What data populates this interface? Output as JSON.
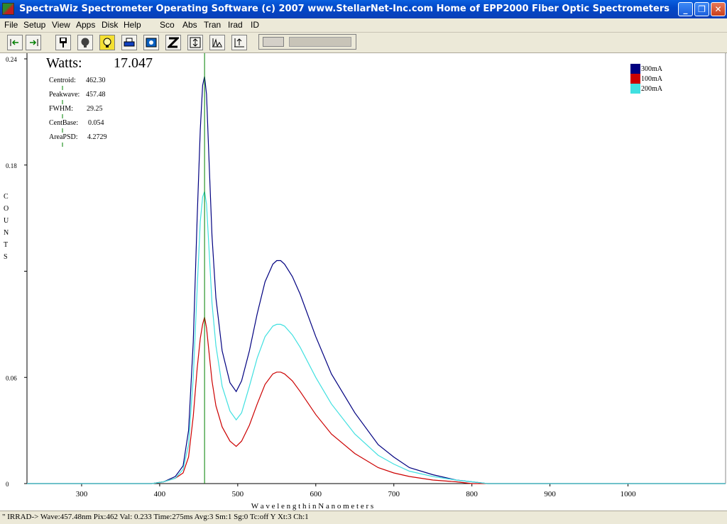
{
  "window": {
    "title": "SpectraWiz  Spectrometer Operating Software (c) 2007  www.StellarNet-Inc.com  Home of EPP2000 Fiber Optic Spectrometers",
    "minimize": "_",
    "maximize": "❐",
    "close": "✕"
  },
  "menu": [
    "File",
    "Setup",
    "View",
    "Apps",
    "Disk",
    "Help",
    "Sco",
    "Abs",
    "Tran",
    "Irad",
    "ID"
  ],
  "toolbar": {
    "buttons": [
      "scroll-left-icon",
      "scroll-right-icon",
      "save-icon",
      "dark-icon",
      "light-bulb-icon",
      "printer-icon",
      "camera-icon",
      "zoom-z-icon",
      "y-scale-icon",
      "peak-icon",
      "export-icon"
    ]
  },
  "measurements": {
    "watts_label": "Watts:",
    "watts_value": "17.047",
    "rows": [
      {
        "label": "Centroid:",
        "value": "462.30"
      },
      {
        "label": "Peakwave:",
        "value": "457.48"
      },
      {
        "label": "FWHM:",
        "value": "29.25"
      },
      {
        "label": "CentBase:",
        "value": "0.054"
      },
      {
        "label": "AreaPSD:",
        "value": "4.2729"
      }
    ]
  },
  "chart_data": {
    "type": "line",
    "xlabel": "W a v e l e n g t h   i n   N a n o m e t e r s",
    "ylabel": "C O U N T S",
    "xlim": [
      230,
      1125
    ],
    "ylim": [
      0,
      0.24
    ],
    "xticks": [
      300,
      400,
      500,
      600,
      700,
      800,
      900,
      1000
    ],
    "yticks": [
      {
        "v": 0,
        "label": "0"
      },
      {
        "v": 0.06,
        "label": "0.06"
      },
      {
        "v": 0.12,
        "label": ""
      },
      {
        "v": 0.18,
        "label": "0.18"
      },
      {
        "v": 0.24,
        "label": "0.24"
      }
    ],
    "cursor_x": 457.5,
    "legend_position": "top-right",
    "series": [
      {
        "name": "300mA",
        "color": "#000080",
        "x": [
          230,
          390,
          405,
          420,
          430,
          437,
          443,
          448,
          452,
          455,
          457.5,
          460,
          463,
          467,
          472,
          480,
          490,
          498,
          505,
          515,
          525,
          535,
          545,
          550,
          555,
          560,
          570,
          580,
          600,
          620,
          650,
          680,
          700,
          720,
          750,
          780,
          800,
          820,
          900,
          1125
        ],
        "y": [
          0,
          0,
          0.001,
          0.004,
          0.01,
          0.03,
          0.08,
          0.15,
          0.2,
          0.225,
          0.23,
          0.22,
          0.185,
          0.14,
          0.105,
          0.075,
          0.057,
          0.052,
          0.058,
          0.075,
          0.096,
          0.114,
          0.124,
          0.126,
          0.126,
          0.124,
          0.117,
          0.107,
          0.083,
          0.062,
          0.04,
          0.022,
          0.015,
          0.009,
          0.005,
          0.002,
          0.001,
          0,
          0,
          0
        ]
      },
      {
        "name": "100mA",
        "color": "#cc0000",
        "x": [
          230,
          390,
          405,
          420,
          430,
          437,
          443,
          448,
          452,
          455,
          457.5,
          460,
          463,
          467,
          472,
          480,
          490,
          498,
          505,
          515,
          525,
          535,
          545,
          550,
          555,
          560,
          570,
          580,
          600,
          620,
          650,
          680,
          700,
          720,
          750,
          780,
          800,
          820,
          900,
          1125
        ],
        "y": [
          0,
          0,
          0.001,
          0.003,
          0.006,
          0.015,
          0.038,
          0.065,
          0.082,
          0.09,
          0.094,
          0.088,
          0.075,
          0.058,
          0.044,
          0.032,
          0.024,
          0.021,
          0.024,
          0.033,
          0.045,
          0.056,
          0.062,
          0.063,
          0.063,
          0.062,
          0.058,
          0.052,
          0.039,
          0.028,
          0.017,
          0.009,
          0.006,
          0.004,
          0.002,
          0.001,
          0,
          0,
          0,
          0
        ]
      },
      {
        "name": "200mA",
        "color": "#40e0e0",
        "x": [
          230,
          390,
          405,
          420,
          430,
          437,
          443,
          448,
          452,
          455,
          457.5,
          460,
          463,
          467,
          472,
          480,
          490,
          498,
          505,
          515,
          525,
          535,
          545,
          550,
          555,
          560,
          570,
          580,
          600,
          620,
          650,
          680,
          700,
          720,
          750,
          780,
          800,
          820,
          900,
          1125
        ],
        "y": [
          0,
          0,
          0.001,
          0.003,
          0.008,
          0.022,
          0.06,
          0.11,
          0.148,
          0.162,
          0.165,
          0.158,
          0.134,
          0.102,
          0.078,
          0.055,
          0.041,
          0.036,
          0.04,
          0.055,
          0.071,
          0.083,
          0.089,
          0.09,
          0.09,
          0.089,
          0.084,
          0.077,
          0.06,
          0.045,
          0.028,
          0.016,
          0.011,
          0.007,
          0.004,
          0.002,
          0.001,
          0,
          0,
          0
        ]
      }
    ]
  },
  "status": {
    "text": "\" IRRAD->   Wave:457.48nm  Pix:462  Val:  0.233 Time:275ms  Avg:3  Sm:1  Sg:0  Tc:off Y  Xt:3  Ch:1"
  }
}
